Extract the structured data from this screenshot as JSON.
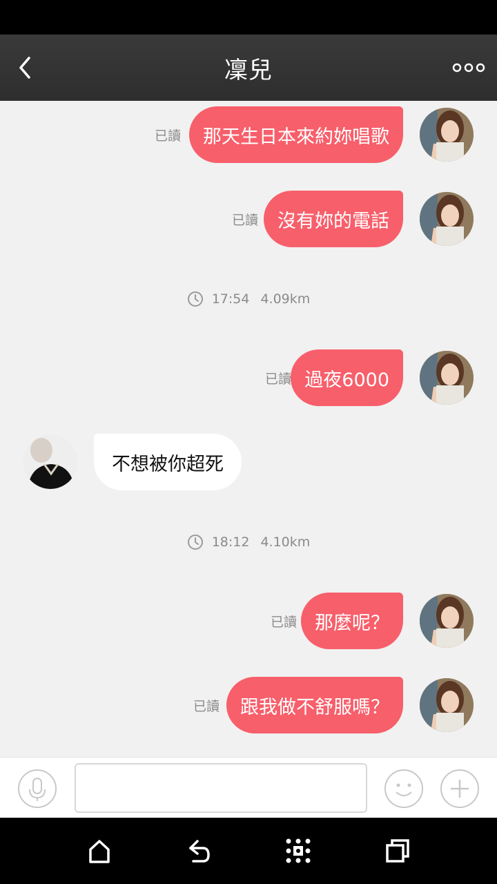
{
  "header": {
    "title": "凜兒"
  },
  "messages": [
    {
      "side": "me",
      "text": "那天生日本來約妳唱歌",
      "read": "已讀"
    },
    {
      "side": "me",
      "text": "沒有妳的電話",
      "read": "已讀"
    },
    {
      "type": "time",
      "time": "17:54",
      "distance": "4.09km"
    },
    {
      "side": "me",
      "text": "過夜6000",
      "read": "已讀"
    },
    {
      "side": "other",
      "text": "不想被你超死"
    },
    {
      "type": "time",
      "time": "18:12",
      "distance": "4.10km"
    },
    {
      "side": "me",
      "text": "那麼呢？",
      "read": "已讀"
    },
    {
      "side": "me",
      "text": "跟我做不舒服嗎？",
      "read": "已讀"
    }
  ],
  "input": {
    "value": "",
    "placeholder": ""
  },
  "icons": {
    "back": "chevron-left-icon",
    "more": "more-dots-icon",
    "mic": "microphone-icon",
    "emoji": "smiley-icon",
    "plus": "plus-icon",
    "nav_home": "home-icon",
    "nav_back": "back-arrow-icon",
    "nav_apps": "apps-grid-icon",
    "nav_recent": "recent-apps-icon"
  },
  "colors": {
    "my_bubble": "#f75f6b",
    "other_bubble": "#ffffff",
    "header_bg": "#333333",
    "chat_bg": "#f1f1f1"
  }
}
